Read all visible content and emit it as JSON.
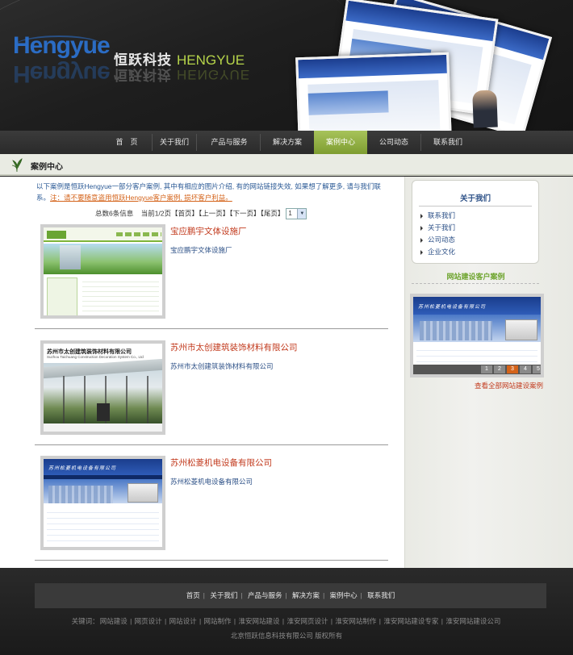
{
  "header": {
    "logo_en": "Hengyue",
    "logo_cn": "恒跃科技",
    "logo_cn_en": "HENGYUE"
  },
  "nav": {
    "items": [
      {
        "label": "首　页"
      },
      {
        "label": "关于我们"
      },
      {
        "label": "产品与服务"
      },
      {
        "label": "解决方案"
      },
      {
        "label": "案例中心",
        "active": true
      },
      {
        "label": "公司动态"
      },
      {
        "label": "联系我们"
      }
    ]
  },
  "page_title": "案例中心",
  "intro": {
    "text": "以下案例是恒跃Hengyue一部分客户案例, 其中有相应的图片介绍, 有的网站链接失效, 如果想了解更多, 请与我们联系。",
    "warning": "注：请不要随意盗用恒跃Hengyue客户案例, 损坏客户利益。"
  },
  "pager": {
    "total": "总数6条信息",
    "current": "当前1/2页",
    "first": "【首页】",
    "prev": "【上一页】",
    "next": "【下一页】",
    "last": "【尾页】",
    "select_value": "1"
  },
  "cases": [
    {
      "title": "宝应鹏宇文体设施厂",
      "desc": "宝应鹏宇文体设施厂"
    },
    {
      "title": "苏州市太创建筑装饰材料有限公司",
      "desc": "苏州市太创建筑装饰材料有限公司",
      "thumb_title": "苏州市太创建筑装饰材料有限公司",
      "thumb_sub": "Suzhou Taichuang Construction Decoration System Co., Ltd"
    },
    {
      "title": "苏州松菱机电设备有限公司",
      "desc": "苏州松菱机电设备有限公司",
      "thumb_title": "苏州松菱机电设备有限公司"
    }
  ],
  "sidebar": {
    "about_title": "关于我们",
    "about_items": [
      "联系我们",
      "关于我们",
      "公司动态",
      "企业文化"
    ],
    "cases_title": "网站建设客户案例",
    "featured_thumb_title": "苏州松菱机电设备有限公司",
    "slider_pages": [
      "1",
      "2",
      "3",
      "4",
      "5"
    ],
    "slider_active": 3,
    "view_all": "查看全部网站建设案例"
  },
  "footer": {
    "nav": [
      "首页",
      "关于我们",
      "产品与服务",
      "解决方案",
      "案例中心",
      "联系我们"
    ],
    "keywords_label": "关键词：",
    "keywords": [
      "网站建设",
      "网页设计",
      "网站设计",
      "网站制作",
      "淮安网站建设",
      "淮安网页设计",
      "淮安网站制作",
      "淮安网站建设专家",
      "淮安网站建设公司"
    ],
    "copyright": "北京恒跃信息科技有限公司 版权所有"
  },
  "colors": {
    "nav_active": "#8fb040",
    "link_blue": "#2b4f86",
    "case_title_red": "#c23a1d",
    "sidebar_green": "#6fa530"
  }
}
